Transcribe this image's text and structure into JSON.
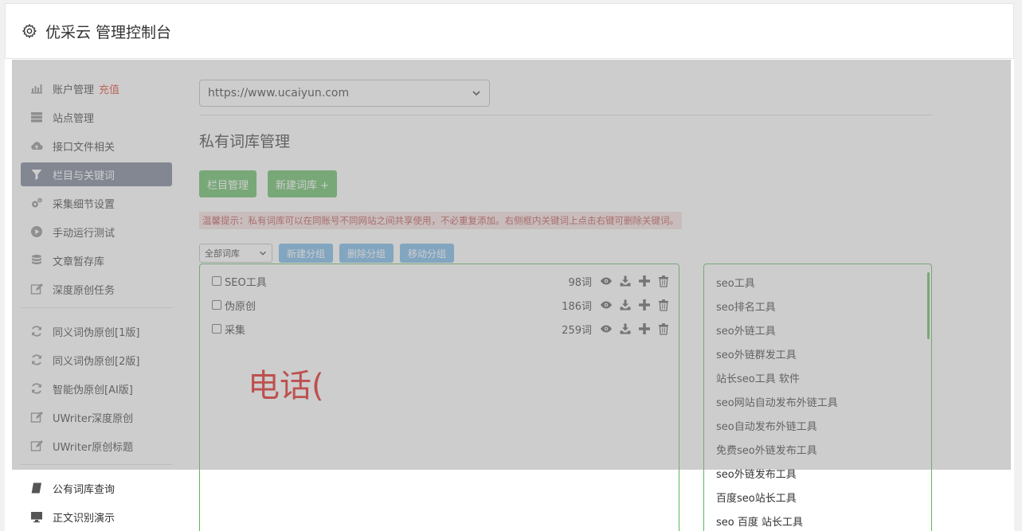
{
  "header": {
    "title": "优采云 管理控制台"
  },
  "sidebar": {
    "items": [
      {
        "label": "账户管理",
        "icon": "bar-chart-icon",
        "extra": "充值"
      },
      {
        "label": "站点管理",
        "icon": "server-icon"
      },
      {
        "label": "接口文件相关",
        "icon": "cloud-upload-icon"
      },
      {
        "label": "栏目与关键词",
        "icon": "filter-icon",
        "active": true
      },
      {
        "label": "采集细节设置",
        "icon": "cogs-icon"
      },
      {
        "label": "手动运行测试",
        "icon": "play-circle-icon"
      },
      {
        "label": "文章暂存库",
        "icon": "database-icon"
      },
      {
        "label": "深度原创任务",
        "icon": "edit-icon"
      }
    ],
    "items2": [
      {
        "label": "同义词伪原创[1版]",
        "icon": "refresh-icon"
      },
      {
        "label": "同义词伪原创[2版]",
        "icon": "refresh-icon"
      },
      {
        "label": "智能伪原创[AI版]",
        "icon": "refresh-icon"
      },
      {
        "label": "UWriter深度原创",
        "icon": "edit-icon"
      },
      {
        "label": "UWriter原创标题",
        "icon": "edit-icon"
      }
    ],
    "items3": [
      {
        "label": "公有词库查询",
        "icon": "book-icon"
      },
      {
        "label": "正文识别演示",
        "icon": "monitor-icon"
      }
    ]
  },
  "main": {
    "site_select": "https://www.ucaiyun.com",
    "page_title": "私有词库管理",
    "btn_column": "栏目管理",
    "btn_new_lib": "新建词库 +",
    "tip": "温馨提示：私有词库可以在同账号不同网站之间共享使用，不必重复添加。右侧框内关键词上点击右键可删除关键词。",
    "filter_select": "全部词库",
    "btn_new_group": "新建分组",
    "btn_delete_group": "删除分组",
    "btn_move_group": "移动分组"
  },
  "groups": [
    {
      "name": "SEO工具",
      "count": "98词"
    },
    {
      "name": "伪原创",
      "count": "186词"
    },
    {
      "name": "采集",
      "count": "259词"
    }
  ],
  "watermark": "电话(",
  "keywords": [
    "seo工具",
    "seo排名工具",
    "seo外链工具",
    "seo外链群发工具",
    "站长seo工具 软件",
    "seo网站自动发布外链工具",
    "seo自动发布外链工具",
    "免费seo外链发布工具",
    "seo外链发布工具",
    "百度seo站长工具",
    "seo 百度 站长工具"
  ],
  "colors": {
    "accent_green": "#5cb85c",
    "accent_blue": "#6fb3e6",
    "active_nav": "#6f7a8f",
    "recharge_red": "#e0382b",
    "watermark_red": "#e0120f"
  }
}
